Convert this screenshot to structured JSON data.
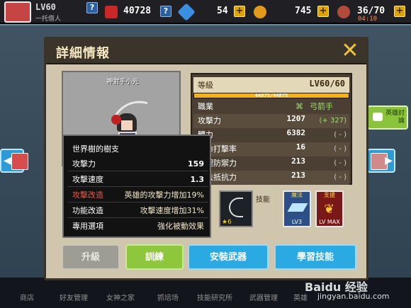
{
  "topbar": {
    "player_level": "LV60",
    "player_name": "一托僧人",
    "gold": "40728",
    "gems": "54",
    "coins": "745",
    "stamina": "36/70",
    "stamina_timer": "04:10"
  },
  "panel": {
    "title": "詳細情報",
    "hero_name": "神射手小光"
  },
  "stats": {
    "level_label": "等級",
    "level_value": "LV60/60",
    "xp_text": "44875/44875",
    "xp_fraction": 1.0,
    "rows": [
      {
        "label": "職業",
        "value": "弓箭手",
        "bonus": ""
      },
      {
        "label": "攻擊力",
        "value": "1207",
        "bonus": "(+ 327)"
      },
      {
        "label": "體力",
        "value": "6382",
        "bonus": "( - )"
      },
      {
        "label": "致命打擊率",
        "value": "16",
        "bonus": "( - )"
      },
      {
        "label": "物理防禦力",
        "value": "213",
        "bonus": "( - )"
      },
      {
        "label": "魔法抵抗力",
        "value": "213",
        "bonus": "( - )"
      }
    ]
  },
  "skills": {
    "label": "技能",
    "weapon_level": "★6",
    "skill1_tag": "魔法",
    "skill1_level": "LV3",
    "skill2_tag": "支援",
    "skill2_level": "LV MAX"
  },
  "tooltip": {
    "title": "世界樹的樹支",
    "attack_label": "攻擊力",
    "attack_value": "159",
    "speed_label": "攻擊速度",
    "speed_value": "1.3",
    "mod1_label": "攻擊改造",
    "mod1_text": "英雄的攻擊力增加19%",
    "mod2_label": "功能改造",
    "mod2_text": "攻擊速度增加31%",
    "special_label": "專用選項",
    "special_text": "強化被動效果"
  },
  "buttons": {
    "upgrade": "升級",
    "train": "訓練",
    "equip": "安裝武器",
    "learn": "學習技能"
  },
  "side": {
    "chat_label": "英雄討論"
  },
  "bottom_nav": [
    "商店",
    "好友管理",
    "女神之家",
    "抓培场",
    "技能研究所",
    "武器管理",
    "英雄"
  ],
  "watermark": {
    "line1": "Baidu 经验",
    "line2": "jingyan.baidu.com"
  }
}
